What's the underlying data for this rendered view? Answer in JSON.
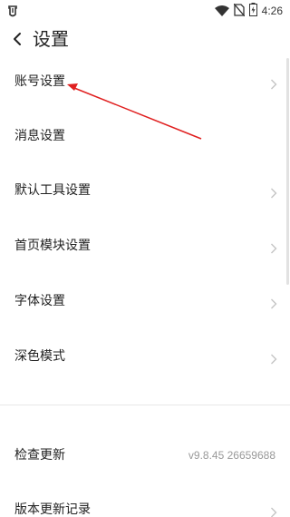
{
  "status_bar": {
    "time": "4:26",
    "icons": [
      "notification-icon",
      "wifi-icon",
      "no-sim-icon",
      "battery-charging-icon"
    ]
  },
  "header": {
    "title": "设置",
    "back_icon": "chevron-left-icon"
  },
  "menu": {
    "items": [
      {
        "label": "账号设置"
      },
      {
        "label": "消息设置"
      },
      {
        "label": "默认工具设置"
      },
      {
        "label": "首页模块设置"
      },
      {
        "label": "字体设置"
      },
      {
        "label": "深色模式"
      }
    ],
    "check_update": {
      "label": "检查更新",
      "value": "v9.8.45 26659688"
    },
    "changelog": {
      "label": "版本更新记录"
    }
  },
  "colors": {
    "annotation_arrow": "#e02020",
    "chevron": "#c4c4c4",
    "secondary_text": "#999999"
  }
}
